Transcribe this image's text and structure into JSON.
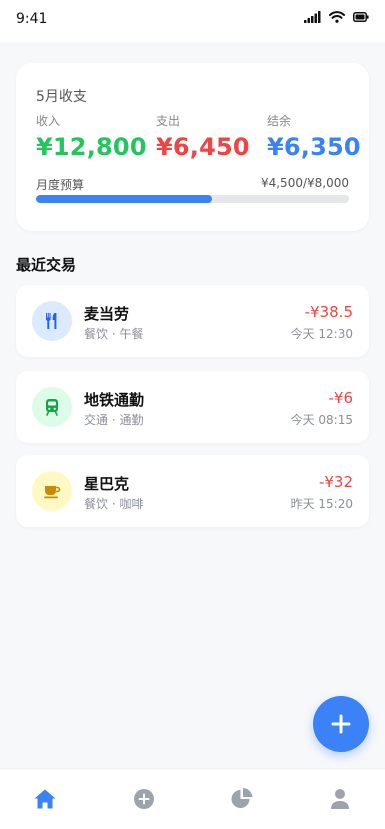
{
  "status_bar": {
    "time": "9:41"
  },
  "summary": {
    "title": "5月收支",
    "income": {
      "label": "收入",
      "value": "¥12,800",
      "color": "#22c55e"
    },
    "expense": {
      "label": "支出",
      "value": "¥6,450",
      "color": "#ef4444"
    },
    "balance": {
      "label": "结余",
      "value": "¥6,350",
      "color": "#3b82f6"
    },
    "budget": {
      "label": "月度预算",
      "amount": "¥4,500/¥8,000",
      "progress": 0.5625
    }
  },
  "transactions_section": {
    "title": "最近交易"
  },
  "transactions": [
    {
      "name": "麦当劳",
      "meta": "餐饮 · 午餐",
      "amount": "-¥38.5",
      "time": "今天 12:30",
      "icon": "utensils-icon",
      "icon_bg": "#dbeafe",
      "icon_color": "#2563eb"
    },
    {
      "name": "地铁通勤",
      "meta": "交通 · 通勤",
      "amount": "-¥6",
      "time": "今天 08:15",
      "icon": "train-icon",
      "icon_bg": "#dcfce7",
      "icon_color": "#16a34a"
    },
    {
      "name": "星巴克",
      "meta": "餐饮 · 咖啡",
      "amount": "-¥32",
      "time": "昨天 15:20",
      "icon": "coffee-icon",
      "icon_bg": "#fef9c3",
      "icon_color": "#ca8a04"
    }
  ],
  "colors": {
    "accent": "#3b82f6",
    "negative": "#ef4444",
    "tab_inactive": "#9ca3af"
  },
  "tab_bar": {
    "items": [
      "home-icon",
      "add-icon",
      "pie-chart-icon",
      "user-icon"
    ],
    "active": "home-icon"
  }
}
